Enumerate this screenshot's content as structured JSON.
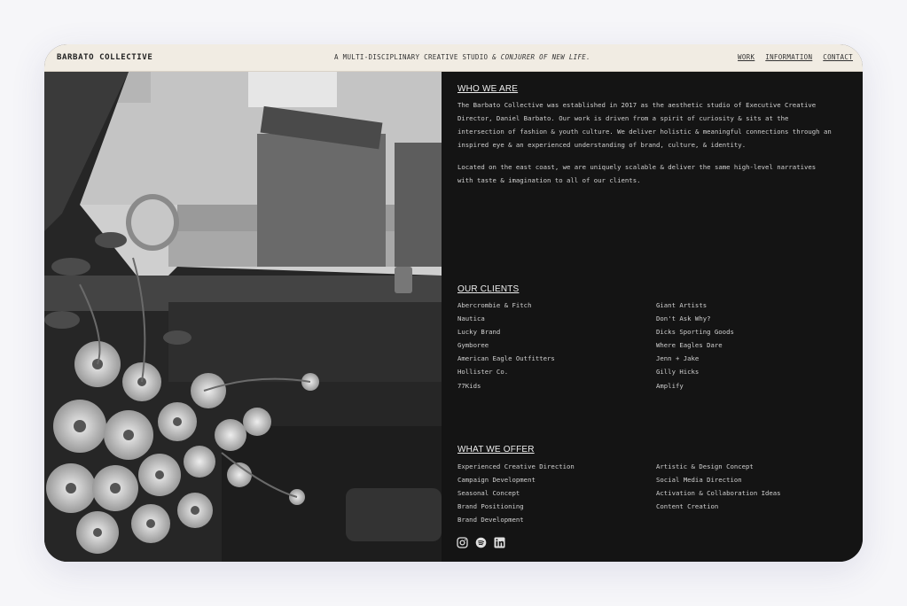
{
  "header": {
    "brand": "BARBATO COLLECTIVE",
    "tagline_main": "A MULTI-DISCIPLINARY CREATIVE STUDIO ",
    "tagline_em": "& CONJURER OF NEW LIFE.",
    "nav": [
      "WORK",
      "INFORMATION",
      "CONTACT"
    ]
  },
  "about": {
    "heading": "WHO WE ARE",
    "lines1": [
      "The Barbato Collective was established in 2017 as the aesthetic studio of Executive Creative",
      "Director, Daniel Barbato. Our work is driven from a spirit of curiosity & sits at the",
      "intersection of fashion & youth culture. We deliver holistic & meaningful connections through an",
      "inspired eye & an experienced understanding of brand, culture, & identity."
    ],
    "lines2": [
      "Located on the east coast, we are uniquely scalable & deliver the same high-level narratives",
      "with taste & imagination to all of our clients."
    ]
  },
  "clients": {
    "heading": "OUR CLIENTS",
    "left": [
      "Abercrombie & Fitch",
      "Nautica",
      "Lucky Brand",
      "Gymboree",
      "American Eagle Outfitters",
      "Hollister Co.",
      "77Kids"
    ],
    "right": [
      "Giant Artists",
      "Don't Ask Why?",
      "Dicks Sporting Goods",
      "Where Eagles Dare",
      "Jenn + Jake",
      "Gilly Hicks",
      "Amplify"
    ]
  },
  "offer": {
    "heading": "WHAT WE OFFER",
    "left": [
      "Experienced Creative Direction",
      "Campaign Development",
      "Seasonal Concept",
      "Brand Positioning",
      "Brand Development"
    ],
    "right": [
      "Artistic & Design Concept",
      "Social Media Direction",
      "Activation & Collaboration Ideas",
      "Content Creation"
    ]
  },
  "social": [
    "instagram-icon",
    "spotify-icon",
    "linkedin-icon"
  ]
}
